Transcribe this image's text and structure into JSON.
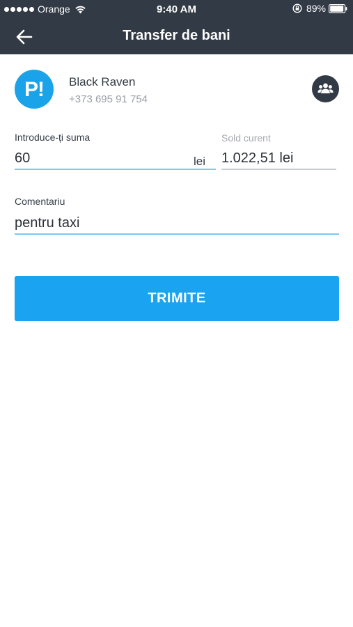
{
  "status_bar": {
    "carrier": "Orange",
    "time": "9:40 AM",
    "battery": "89%"
  },
  "header": {
    "title": "Transfer de bani"
  },
  "recipient": {
    "logo_text": "P!",
    "name": "Black Raven",
    "phone": "+373 695 91 754"
  },
  "amount": {
    "label": "Introduce-ți suma",
    "value": "60",
    "unit": "lei"
  },
  "balance": {
    "label": "Sold curent",
    "value": "1.022,51 lei"
  },
  "comment": {
    "label": "Comentariu",
    "value": "pentru taxi"
  },
  "send_button": {
    "label": "TRIMITE"
  },
  "colors": {
    "header_bg": "#323a45",
    "accent": "#1aa3f0",
    "underline_active": "#7ec8f0"
  },
  "icons": [
    "wifi-icon",
    "orientation-lock-icon",
    "battery-icon",
    "back-arrow-icon",
    "contacts-icon"
  ]
}
